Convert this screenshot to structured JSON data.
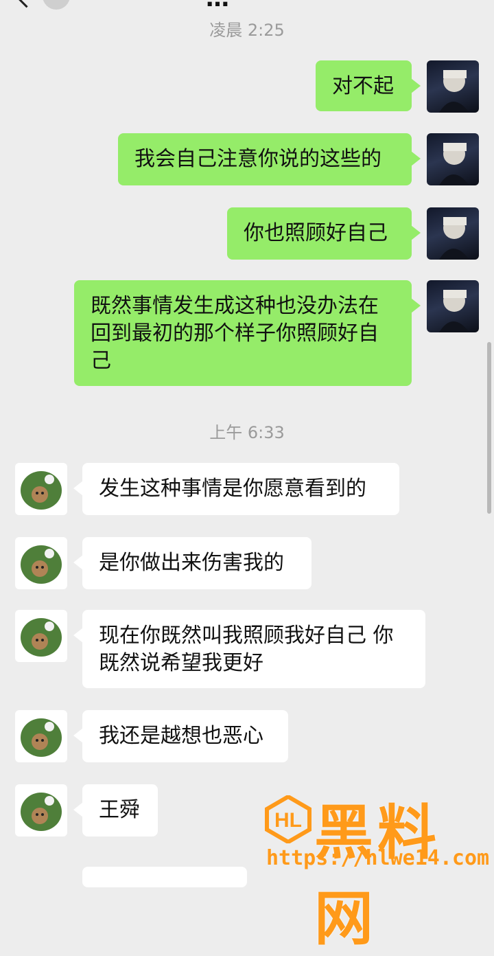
{
  "header": {
    "title_fragment": "…"
  },
  "times": {
    "t1": "凌晨 2:25",
    "t2": "上午 6:33"
  },
  "messages": [
    {
      "from": "me",
      "text": "对不起"
    },
    {
      "from": "me",
      "text": "我会自己注意你说的这些的"
    },
    {
      "from": "me",
      "text": "你也照顾好自己"
    },
    {
      "from": "me",
      "text": "既然事情发生成这种也没办法在\n回到最初的那个样子你照顾好自\n己"
    },
    {
      "from": "them",
      "text": "发生这种事情是你愿意看到的"
    },
    {
      "from": "them",
      "text": "是你做出来伤害我的"
    },
    {
      "from": "them",
      "text": "现在你既然叫我照顾我好自己 你\n既然说希望我更好"
    },
    {
      "from": "them",
      "text": "我还是越想也恶心"
    },
    {
      "from": "them",
      "text": "王舜"
    }
  ],
  "watermark": {
    "brand": "黑料网",
    "url": "https://hlwe14.com",
    "color": "#ff9a1a"
  },
  "colors": {
    "me_bubble": "#95ec69",
    "them_bubble": "#ffffff",
    "background": "#ededed"
  }
}
